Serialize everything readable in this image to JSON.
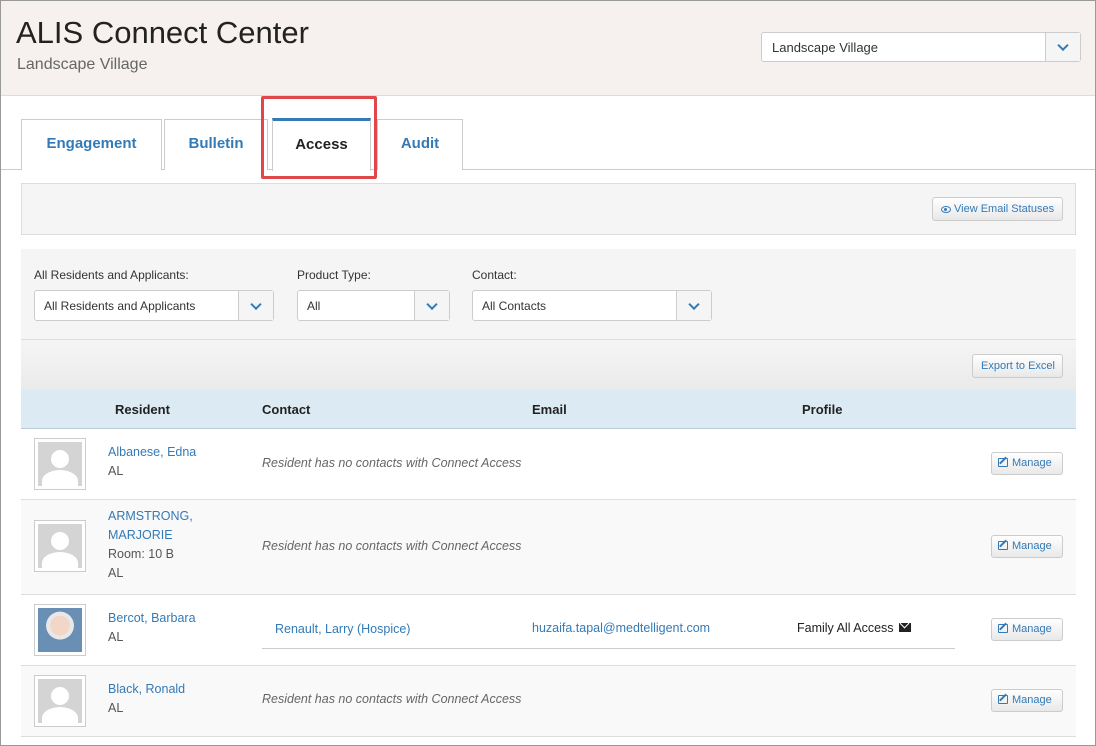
{
  "header": {
    "title": "ALIS Connect Center",
    "subtitle": "Landscape Village",
    "facility_select": "Landscape Village"
  },
  "tabs": [
    {
      "label": "Engagement"
    },
    {
      "label": "Bulletin"
    },
    {
      "label": "Access"
    },
    {
      "label": "Audit"
    }
  ],
  "active_tab": "Access",
  "toolbar": {
    "view_email_statuses": "View Email Statuses",
    "export_to_excel": "Export to Excel"
  },
  "filters": {
    "residents": {
      "label": "All Residents and Applicants:",
      "value": "All Residents and Applicants"
    },
    "product_type": {
      "label": "Product Type:",
      "value": "All"
    },
    "contact": {
      "label": "Contact:",
      "value": "All Contacts"
    }
  },
  "table": {
    "columns": [
      "Resident",
      "Contact",
      "Email",
      "Profile"
    ],
    "rows": [
      {
        "name": "Albanese, Edna",
        "meta": [
          "AL"
        ],
        "contact_note": "Resident has no contacts with Connect Access",
        "action": "Manage"
      },
      {
        "name_lines": [
          "ARMSTRONG,",
          "MARJORIE"
        ],
        "meta": [
          "Room: 10 B",
          "AL"
        ],
        "contact_note": "Resident has no contacts with Connect Access",
        "action": "Manage"
      },
      {
        "name": "Bercot, Barbara",
        "meta": [
          "AL"
        ],
        "contact": "Renault, Larry (Hospice)",
        "email": "huzaifa.tapal@medtelligent.com",
        "profile": "Family All Access",
        "action": "Manage"
      },
      {
        "name": "Black, Ronald",
        "meta": [
          "AL"
        ],
        "contact_note": "Resident has no contacts with Connect Access",
        "action": "Manage"
      }
    ]
  },
  "icons": {
    "chevron": "chevron-down-icon",
    "eye": "eye-icon",
    "edit": "edit-icon",
    "mail": "envelope-icon",
    "avatar": "default-avatar-icon"
  },
  "colors": {
    "accent": "#337ab7",
    "header_bg": "#f6f0ee",
    "table_head_bg": "#dcebf3",
    "highlight": "#e0474a"
  }
}
